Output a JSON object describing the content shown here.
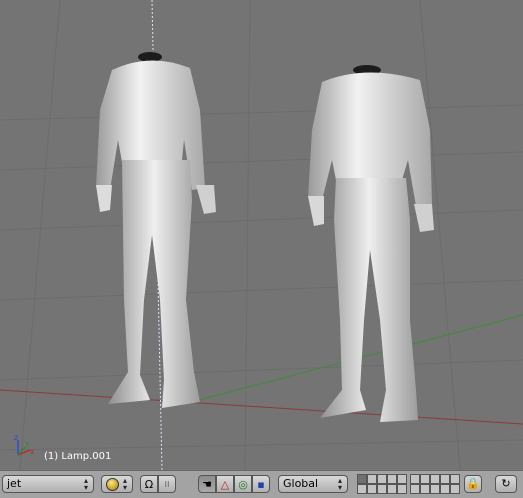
{
  "viewport": {
    "status_text": "(1) Lamp.001",
    "axis_labels": {
      "x": "x",
      "y": "y",
      "z": "z"
    },
    "colors": {
      "background": "#747474",
      "grid": "#6a6a6a",
      "x_axis": "#8c3a3a",
      "y_axis": "#3f8a3f",
      "cursor_line": "#e6d0ff"
    }
  },
  "header": {
    "editor_type_icon": "3d-view-icon",
    "layout_select": {
      "value": "jet"
    },
    "view_menu_icon": "sphere-shading-icon",
    "pivot_icons": [
      "curve-icon",
      "dots-icon"
    ],
    "manipulator_icons": [
      "hand-icon",
      "triangle-icon",
      "ring-icon",
      "square-icon"
    ],
    "orientation_select": {
      "value": "Global"
    },
    "lock_icon": "lock-icon",
    "render_icon": "loop-icon"
  }
}
